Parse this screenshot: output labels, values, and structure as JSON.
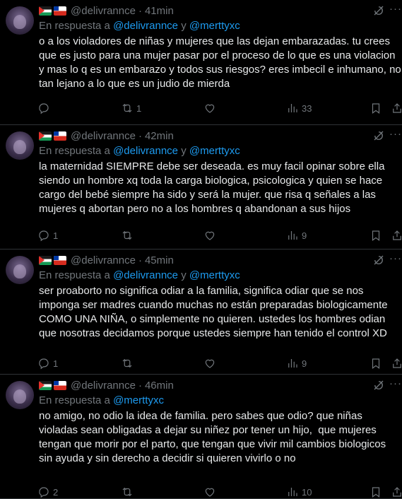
{
  "tweets": [
    {
      "username": "@delivrannce",
      "time": "41min",
      "reply_prefix": "En respuesta a ",
      "reply_mention_1": "@delivrannce",
      "reply_and": " y ",
      "reply_mention_2": "@merttyxc",
      "lines": [
        "o a los violadores de niñas y mujeres que las dejan embarazadas. tu crees",
        "que es justo para una mujer pasar por el proceso de lo que es una violacion",
        "y mas lo q es un embarazo y todos sus riesgos? eres imbecil e inhumano, no",
        "tan lejano a lo que es un judio de mierda"
      ],
      "replies": "",
      "retweets": "1",
      "likes": "",
      "views": "33"
    },
    {
      "username": "@delivrannce",
      "time": "42min",
      "reply_prefix": "En respuesta a ",
      "reply_mention_1": "@delivrannce",
      "reply_and": " y ",
      "reply_mention_2": "@merttyxc",
      "lines": [
        "la maternidad SIEMPRE debe ser deseada. es muy facil opinar sobre ella",
        "siendo un hombre xq toda la carga biologica, psicologica y quien se hace",
        "cargo del bebé siempre ha sido y será la mujer. que risa q señales a las",
        "mujeres q abortan pero no a los hombres q abandonan a sus hijos"
      ],
      "replies": "1",
      "retweets": "",
      "likes": "",
      "views": "9"
    },
    {
      "username": "@delivrannce",
      "time": "45min",
      "reply_prefix": "En respuesta a ",
      "reply_mention_1": "@delivrannce",
      "reply_and": " y ",
      "reply_mention_2": "@merttyxc",
      "lines": [
        "ser proaborto no significa odiar a la familia, significa odiar que se nos",
        "imponga ser madres cuando muchas no están preparadas biologicamente",
        "COMO UNA NIÑA, o simplemente no quieren. ustedes los hombres odian",
        "que nosotras decidamos porque ustedes siempre han tenido el control XD"
      ],
      "replies": "1",
      "retweets": "",
      "likes": "",
      "views": "9"
    },
    {
      "username": "@delivrannce",
      "time": "46min",
      "reply_prefix": "En respuesta a ",
      "reply_mention_1": "@merttyxc",
      "reply_and": "",
      "reply_mention_2": "",
      "lines": [
        "no amigo, no odio la idea de familia. pero sabes que odio? que niñas",
        "violadas sean obligadas a dejar su niñez por tener un hijo,  que mujeres",
        "tengan que morir por el parto, que tengan que vivir mil cambios biologicos",
        "sin ayuda y sin derecho a decidir si quieren vivirlo o no"
      ],
      "replies": "2",
      "retweets": "",
      "likes": "",
      "views": "10"
    }
  ],
  "icons": {
    "reply": "reply-icon",
    "retweet": "retweet-icon",
    "like": "heart-icon",
    "views": "views-icon",
    "bookmark": "bookmark-icon",
    "share": "share-icon",
    "grok": "grok-icon",
    "more": "more-icon"
  },
  "colors": {
    "background": "#000000",
    "text": "#e7e9ea",
    "muted": "#71767b",
    "link": "#1d9bf0",
    "border": "#2f3336"
  }
}
